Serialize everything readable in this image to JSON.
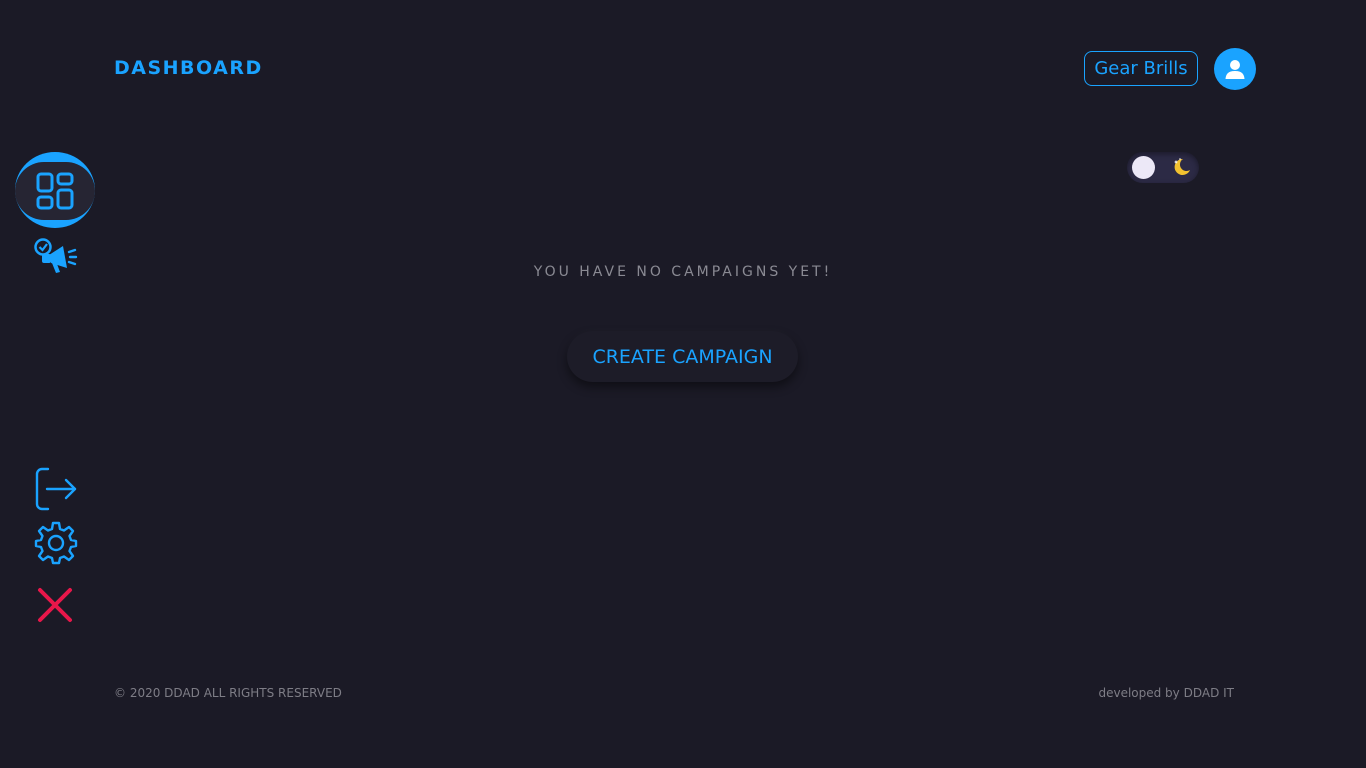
{
  "header": {
    "title": "DASHBOARD",
    "user_name": "Gear Brills"
  },
  "theme_toggle": {
    "state": "dark"
  },
  "sidebar": {
    "items": [
      {
        "name": "dashboard",
        "icon": "dashboard-grid-icon",
        "active": true
      },
      {
        "name": "campaigns",
        "icon": "megaphone-icon",
        "active": false
      }
    ],
    "bottom_items": [
      {
        "name": "logout",
        "icon": "logout-icon"
      },
      {
        "name": "settings",
        "icon": "gear-icon"
      },
      {
        "name": "close",
        "icon": "close-icon"
      }
    ]
  },
  "main": {
    "empty_message": "YOU HAVE NO CAMPAIGNS YET!",
    "create_button_label": "CREATE CAMPAIGN"
  },
  "footer": {
    "copyright": "© 2020 DDAD ALL RIGHTS RESERVED",
    "developer": "developed by DDAD IT"
  },
  "colors": {
    "background": "#1b1a26",
    "accent": "#1aa3ff",
    "danger": "#e8174a",
    "muted_text": "#8a8a93"
  }
}
